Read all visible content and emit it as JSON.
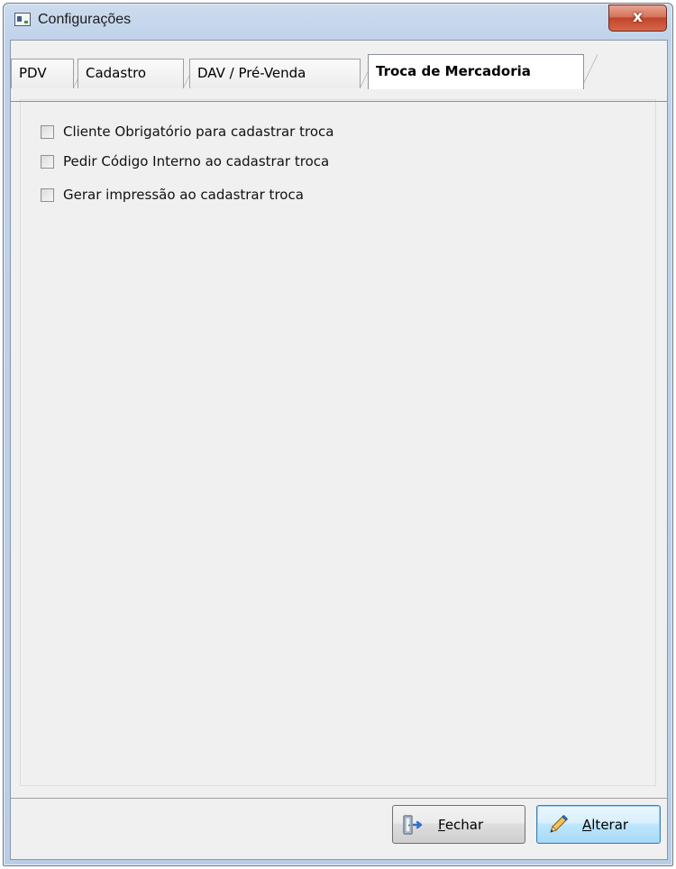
{
  "window": {
    "title": "Configurações",
    "close_label": "x"
  },
  "tabs": [
    {
      "label": "PDV",
      "active": false
    },
    {
      "label": "Cadastro",
      "active": false
    },
    {
      "label": "DAV / Pré-Venda",
      "active": false
    },
    {
      "label": "Troca de Mercadoria",
      "active": true
    }
  ],
  "options": [
    {
      "label": "Cliente Obrigatório para cadastrar troca",
      "checked": false
    },
    {
      "label": "Pedir Código Interno ao cadastrar troca",
      "checked": false
    },
    {
      "label": "Gerar impressão ao cadastrar troca",
      "checked": false
    }
  ],
  "buttons": {
    "close": {
      "accel": "F",
      "rest": "echar",
      "icon": "exit-door-icon"
    },
    "edit": {
      "accel": "A",
      "rest": "lterar",
      "icon": "pencil-icon"
    }
  }
}
